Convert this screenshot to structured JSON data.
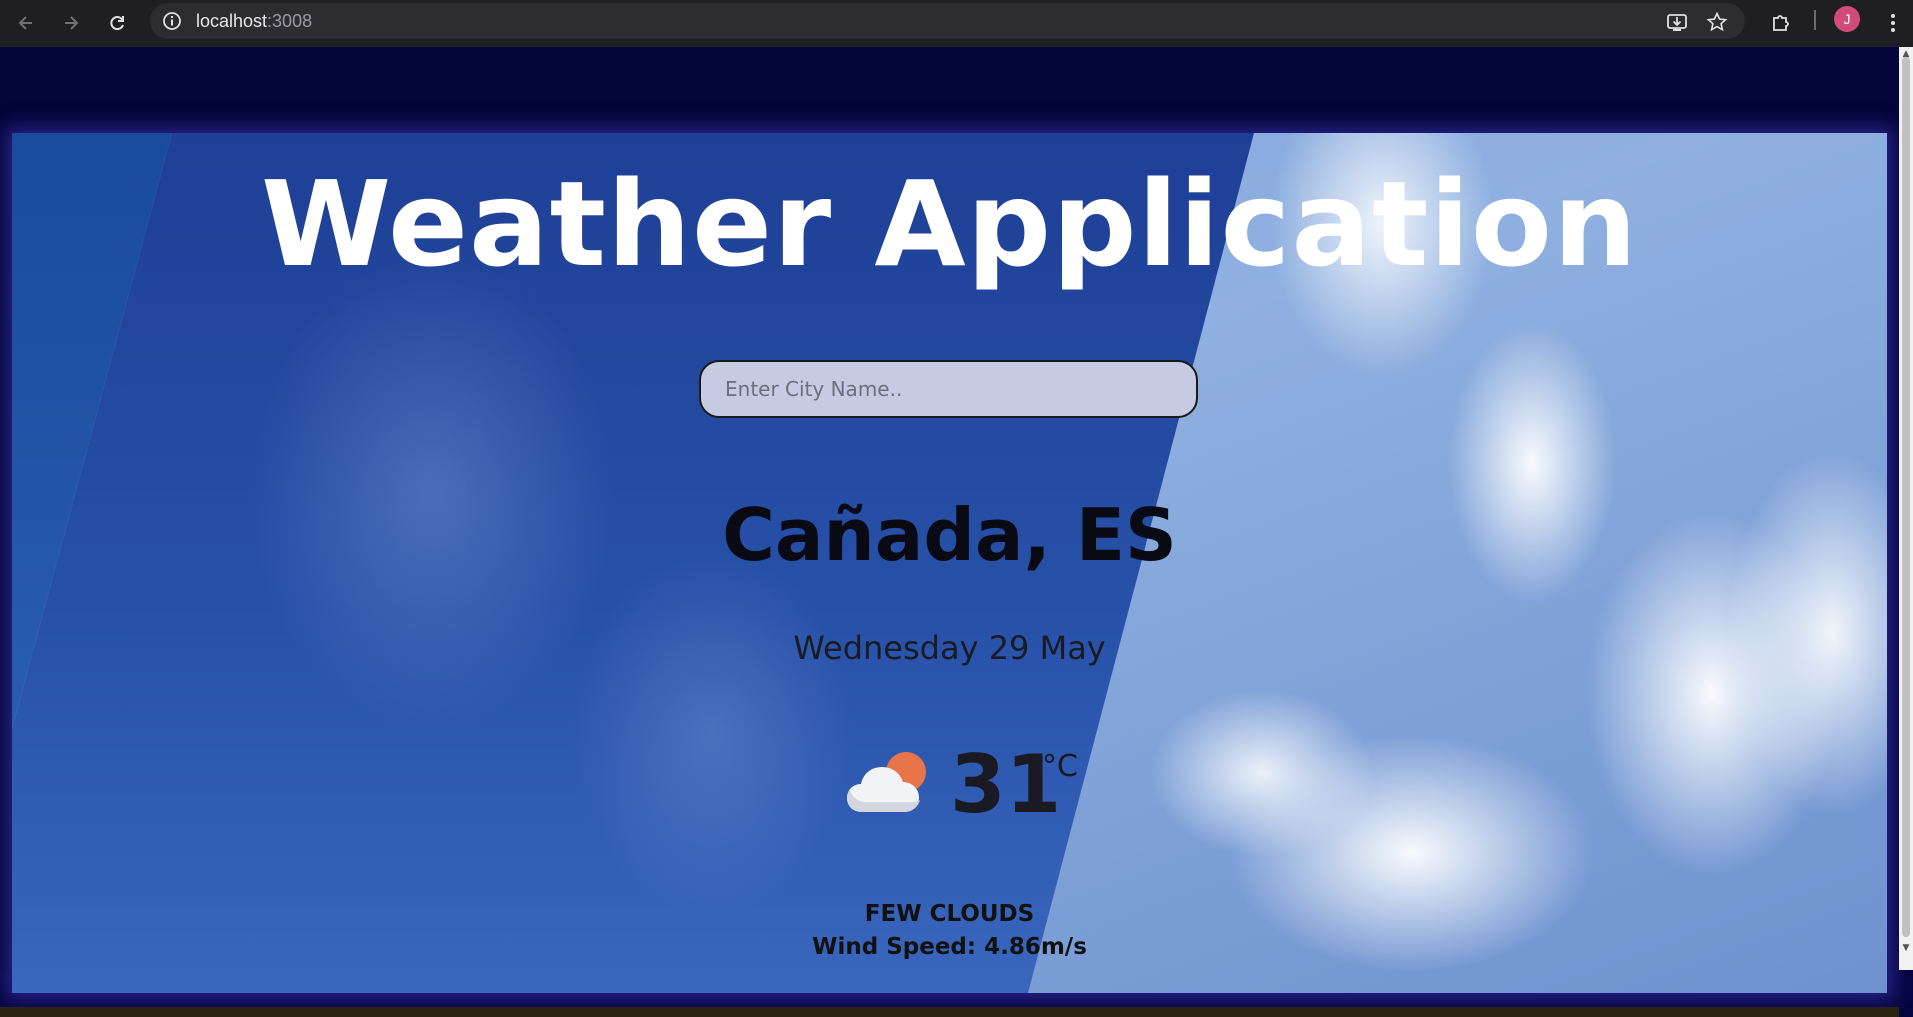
{
  "browser": {
    "url_host": "localhost",
    "url_port": ":3008",
    "profile_initial": "J"
  },
  "app": {
    "title": "Weather Application",
    "search_placeholder": "Enter City Name..",
    "city": "Cañada, ES",
    "date": "Wednesday 29 May",
    "temperature": "31",
    "unit": "°C",
    "description": "FEW CLOUDS",
    "wind": "Wind Speed: 4.86m/s",
    "weather_icon": "cloud-sun-icon"
  },
  "colors": {
    "page_background": "#04053a",
    "title": "#ffffff",
    "search_background": "#c6cbe3"
  }
}
